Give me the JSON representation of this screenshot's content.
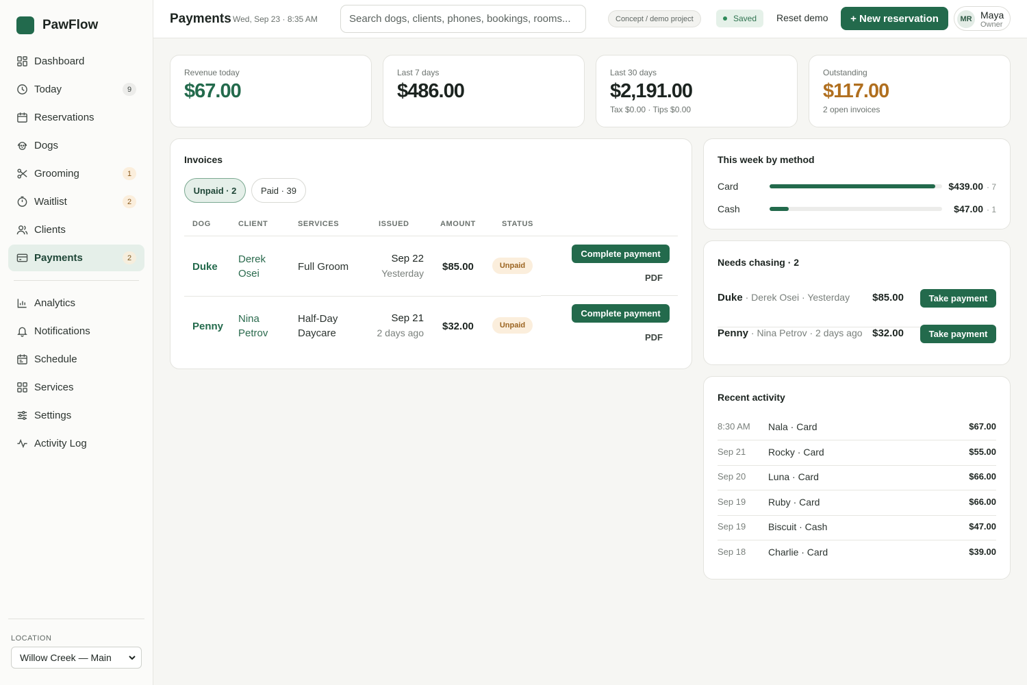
{
  "app": {
    "name": "PawFlow"
  },
  "sidebar": {
    "items": [
      {
        "label": "Dashboard",
        "icon": "dashboard-icon"
      },
      {
        "label": "Today",
        "icon": "clock-icon",
        "count": "9"
      },
      {
        "label": "Reservations",
        "icon": "calendar-icon"
      },
      {
        "label": "Dogs",
        "icon": "dog-icon"
      },
      {
        "label": "Grooming",
        "icon": "scissors-icon",
        "count": "1"
      },
      {
        "label": "Waitlist",
        "icon": "waitlist-clock-icon",
        "count": "2"
      },
      {
        "label": "Clients",
        "icon": "users-icon"
      },
      {
        "label": "Payments",
        "icon": "card-icon",
        "count": "2",
        "active": true
      },
      {
        "label": "Analytics",
        "icon": "bar-chart-icon"
      },
      {
        "label": "Notifications",
        "icon": "bell-icon"
      },
      {
        "label": "Schedule",
        "icon": "schedule-icon"
      },
      {
        "label": "Services",
        "icon": "grid-icon"
      },
      {
        "label": "Settings",
        "icon": "sliders-icon"
      },
      {
        "label": "Activity Log",
        "icon": "activity-icon"
      }
    ],
    "location_label": "LOCATION",
    "location_value": "Willow Creek — Main"
  },
  "header": {
    "title": "Payments",
    "date": "Wed, Sep 23 · 8:35 AM",
    "search_placeholder": "Search dogs, clients, phones, bookings, rooms...",
    "demo_badge": "Concept / demo project",
    "saved_label": "Saved",
    "reset_label": "Reset demo",
    "new_button": "+ New reservation",
    "user": {
      "initials": "MR",
      "name": "Maya",
      "role": "Owner"
    }
  },
  "stats": [
    {
      "label": "Revenue today",
      "value": "$67.00",
      "sub": ""
    },
    {
      "label": "Last 7 days",
      "value": "$486.00",
      "sub": ""
    },
    {
      "label": "Last 30 days",
      "value": "$2,191.00",
      "sub": "Tax $0.00 · Tips $0.00"
    },
    {
      "label": "Outstanding",
      "value": "$117.00",
      "sub": "2 open invoices"
    }
  ],
  "invoices": {
    "title": "Invoices",
    "tabs": [
      {
        "label": "Unpaid · 2"
      },
      {
        "label": "Paid · 39"
      }
    ],
    "columns": [
      "DOG",
      "CLIENT",
      "SERVICES",
      "ISSUED",
      "AMOUNT",
      "STATUS"
    ],
    "rows": [
      {
        "dog": "Duke",
        "client_first": "Derek",
        "client_last": "Osei",
        "service_line1": "Full Groom",
        "service_line2": "",
        "issued_date": "Sep 22",
        "issued_rel": "Yesterday",
        "amount": "$85.00",
        "status": "Unpaid",
        "action": "Complete payment",
        "pdf": "PDF"
      },
      {
        "dog": "Penny",
        "client_first": "Nina",
        "client_last": "Petrov",
        "service_line1": "Half-Day",
        "service_line2": "Daycare",
        "issued_date": "Sep 21",
        "issued_rel": "2 days ago",
        "amount": "$32.00",
        "status": "Unpaid",
        "action": "Complete payment",
        "pdf": "PDF"
      }
    ]
  },
  "by_method": {
    "title": "This week by method",
    "rows": [
      {
        "method": "Card",
        "amount": "$439.00",
        "count": "· 7",
        "share": 0.96
      },
      {
        "method": "Cash",
        "amount": "$47.00",
        "count": "· 1",
        "share": 0.11
      }
    ]
  },
  "chasing": {
    "title": "Needs chasing · 2",
    "rows": [
      {
        "dog": "Duke",
        "meta": " · Derek Osei · Yesterday",
        "amount": "$85.00",
        "action": "Take payment"
      },
      {
        "dog": "Penny",
        "meta": " · Nina Petrov · 2 days ago",
        "amount": "$32.00",
        "action": "Take payment"
      }
    ]
  },
  "activity": {
    "title": "Recent activity",
    "rows": [
      {
        "time": "8:30 AM",
        "desc": "Nala · Card",
        "amount": "$67.00"
      },
      {
        "time": "Sep 21",
        "desc": "Rocky · Card",
        "amount": "$55.00"
      },
      {
        "time": "Sep 20",
        "desc": "Luna · Card",
        "amount": "$66.00"
      },
      {
        "time": "Sep 19",
        "desc": "Ruby · Card",
        "amount": "$66.00"
      },
      {
        "time": "Sep 19",
        "desc": "Biscuit · Cash",
        "amount": "$47.00"
      },
      {
        "time": "Sep 18",
        "desc": "Charlie · Card",
        "amount": "$39.00"
      }
    ]
  },
  "colors": {
    "accent": "#236a4c",
    "warning": "#b06f1f",
    "background": "#f6f6f3"
  }
}
